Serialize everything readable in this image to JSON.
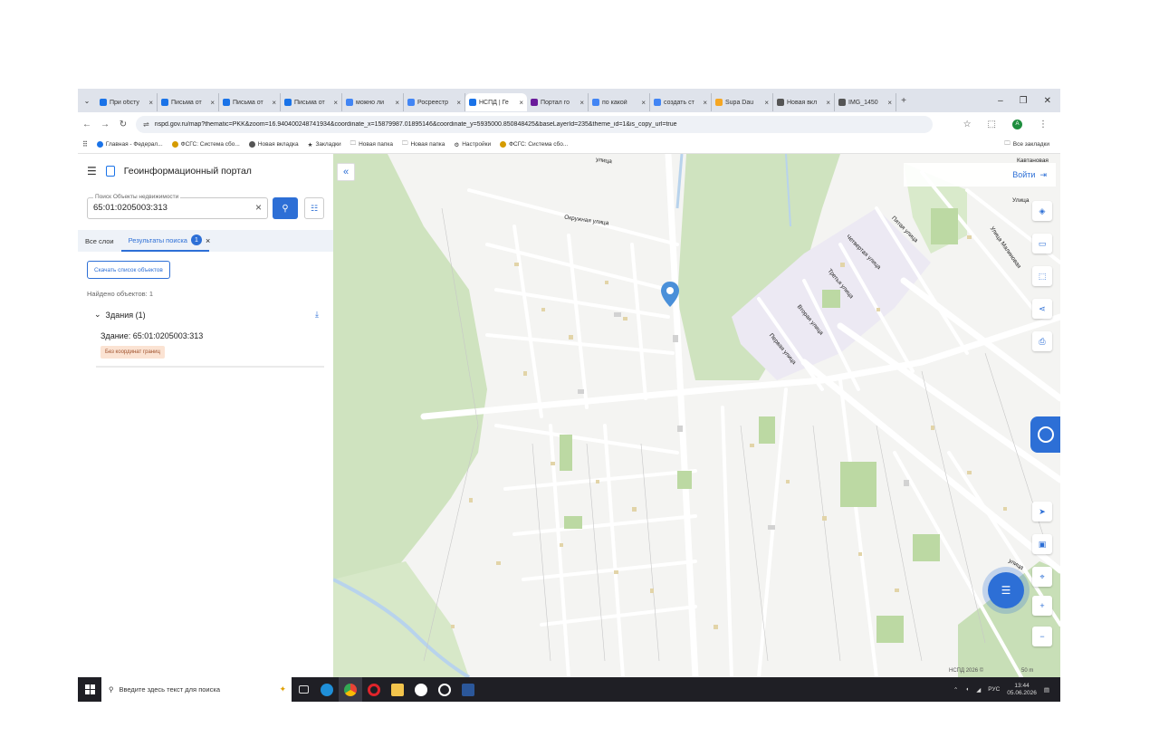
{
  "browser": {
    "tabs": [
      {
        "label": "При обсту",
        "color": "#1a73e8"
      },
      {
        "label": "Письма от",
        "color": "#1a73e8"
      },
      {
        "label": "Письма от",
        "color": "#1a73e8"
      },
      {
        "label": "Письма от",
        "color": "#1a73e8"
      },
      {
        "label": "можно ли",
        "color": "#4285f4"
      },
      {
        "label": "Росреестр",
        "color": "#4285f4"
      },
      {
        "label": "НСПД | Ге",
        "color": "#1a73e8",
        "active": true
      },
      {
        "label": "Портал го",
        "color": "#6a1b9a"
      },
      {
        "label": "по какой",
        "color": "#4285f4"
      },
      {
        "label": "создать ст",
        "color": "#4285f4"
      },
      {
        "label": "Supa Dau",
        "color": "#f5a623"
      },
      {
        "label": "Новая вкл",
        "color": "#555555"
      },
      {
        "label": "IMG_1450",
        "color": "#555555"
      }
    ],
    "url": "nspd.gov.ru/map?thematic=PKK&zoom=16.940400248741934&coordinate_x=15879987.01895146&coordinate_y=5935000.850848425&baseLayerId=235&theme_id=1&is_copy_url=true",
    "bookmarks": [
      {
        "label": "Главная - Федерал..."
      },
      {
        "label": "ФСГС: Система сбо..."
      },
      {
        "label": "Новая вкладка"
      },
      {
        "label": "Закладки"
      },
      {
        "label": "Новая папка"
      },
      {
        "label": "Новая папка"
      },
      {
        "label": "Настройки"
      },
      {
        "label": "ФСГС: Система сбо..."
      }
    ],
    "all_bookmarks": "Все закладки",
    "profile_initial": "A"
  },
  "panel": {
    "title": "Геоинформационный портал",
    "search_label": "Поиск Объекты недвижимости",
    "search_value": "65:01:0205003:313",
    "tab_all": "Все слои",
    "tab_results": "Результаты поиска",
    "results_count": "1",
    "download_list": "Скачать список объектов",
    "found": "Найдено объектов: 1",
    "group": "Здания (1)",
    "item_name": "Здание: 65:01:0205003:313",
    "item_tag": "Без координат границ"
  },
  "map": {
    "login": "Войти",
    "labels": {
      "okruzhnaya": "Окружная улица",
      "vokzalnaya": "улица",
      "kavtanovaya": "Кавтановая",
      "pyataya": "Пятая улица",
      "chetvertaya": "Четвертая улица",
      "tretya": "Третья улица",
      "vtoraya": "Вторая улица",
      "pervaya": "Первая улица",
      "malinovaya": "Улица Малиновая",
      "ulitsa_corner": "Улица",
      "ulitsa_bottom": "улица"
    },
    "attribution": "НСПД 2026 ©",
    "scale": "50 m"
  },
  "taskbar": {
    "search_placeholder": "Введите здесь текст для поиска",
    "lang": "РУС",
    "time": "13:44",
    "date": "05.06.2026"
  }
}
